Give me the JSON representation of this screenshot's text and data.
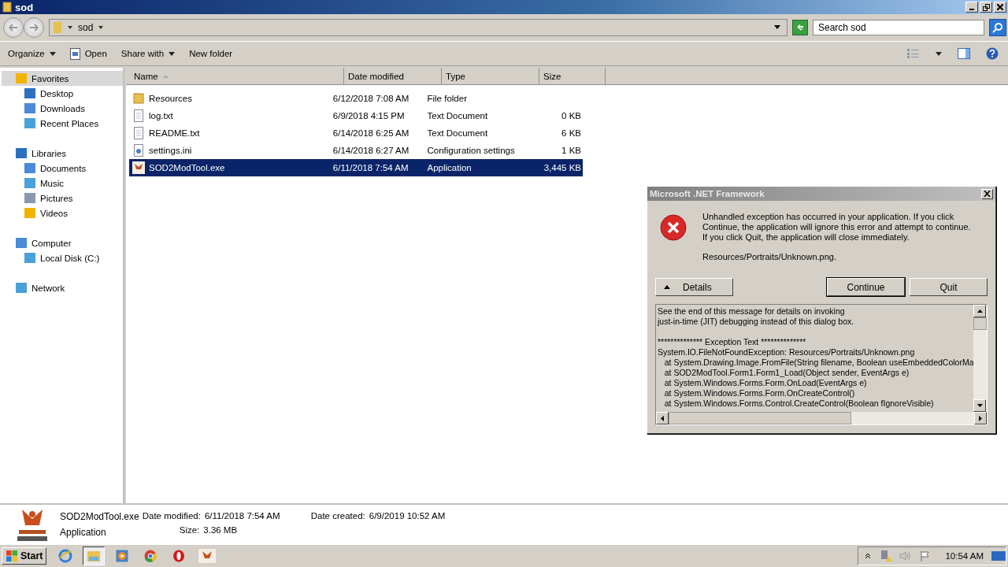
{
  "window": {
    "title": "sod"
  },
  "address": {
    "crumbs": [
      "sod"
    ]
  },
  "search": {
    "placeholder": "Search sod"
  },
  "toolbar": {
    "items": [
      {
        "label": "Organize",
        "kind": "menu"
      },
      {
        "label": "Open",
        "kind": "open"
      },
      {
        "label": "Share with",
        "kind": "menu"
      },
      {
        "label": "New folder",
        "kind": "plain"
      }
    ]
  },
  "sidebar": {
    "items": [
      {
        "label": "Favorites",
        "selected": true,
        "children": [
          {
            "label": "Desktop",
            "selected": false
          },
          {
            "label": "Downloads",
            "selected": false
          },
          {
            "label": "Recent Places",
            "selected": false
          }
        ]
      },
      {
        "label": "Libraries",
        "selected": false,
        "children": [
          {
            "label": "Documents",
            "selected": false
          },
          {
            "label": "Music",
            "selected": false
          },
          {
            "label": "Pictures",
            "selected": false
          },
          {
            "label": "Videos",
            "selected": false
          }
        ]
      },
      {
        "label": "Computer",
        "selected": false,
        "children": [
          {
            "label": "Local Disk (C:)",
            "selected": false
          }
        ]
      },
      {
        "label": "Network",
        "selected": false
      }
    ]
  },
  "table": {
    "columns": [
      {
        "label": "Name",
        "sorted": true
      },
      {
        "label": "Date modified",
        "sorted": false
      },
      {
        "label": "Type",
        "sorted": false
      },
      {
        "label": "Size",
        "sorted": false
      }
    ],
    "rows": [
      {
        "kind": "folder",
        "name": "Resources",
        "date": "6/12/2018 7:08 AM",
        "type": "File folder",
        "selected": false
      },
      {
        "kind": "text",
        "name": "log.txt",
        "date": "6/9/2018 4:15 PM",
        "type": "Text Document",
        "size": "0 KB",
        "selected": false
      },
      {
        "kind": "text",
        "name": "README.txt",
        "date": "6/14/2018 6:25 AM",
        "type": "Text Document",
        "size": "6 KB",
        "selected": false
      },
      {
        "kind": "settings",
        "name": "settings.ini",
        "date": "6/14/2018 6:27 AM",
        "type": "Configuration settings",
        "size": "1 KB",
        "selected": false
      },
      {
        "kind": "app",
        "name": "SOD2ModTool.exe",
        "date": "6/11/2018 7:54 AM",
        "type": "Application",
        "size": "3,445 KB",
        "selected": true
      }
    ]
  },
  "details_pane": {
    "name": "SOD2ModTool.exe",
    "type": "Application",
    "fields": [
      {
        "label": "Date modified:",
        "value": "6/11/2018 7:54 AM"
      },
      {
        "label": "Size:",
        "value": "3.36 MB"
      },
      {
        "label": "Date created:",
        "value": "6/9/2019 10:52 AM"
      }
    ]
  },
  "dialog": {
    "title": "Microsoft .NET Framework",
    "message": "Unhandled exception has occurred in your application. If you click Continue, the application will ignore this error and attempt to continue. If you click Quit, the application will close immediately.",
    "detail": "Resources/Portraits/Unknown.png.",
    "details_button": "Details",
    "buttons": [
      {
        "label": "Continue",
        "selected": true
      },
      {
        "label": "Quit",
        "selected": false
      }
    ],
    "log": [
      [
        "See the end of this message for details on invoking",
        "just-in-time (JIT) debugging instead of this dialog box."
      ],
      [
        "************** Exception Text **************",
        "System.IO.FileNotFoundException: Resources/Portraits/Unknown.png",
        "   at System.Drawing.Image.FromFile(String filename, Boolean useEmbeddedColorMa",
        "   at SOD2ModTool.Form1.Form1_Load(Object sender, EventArgs e)",
        "   at System.Windows.Forms.Form.OnLoad(EventArgs e)",
        "   at System.Windows.Forms.Form.OnCreateControl()",
        "   at System.Windows.Forms.Control.CreateControl(Boolean fIgnoreVisible)"
      ]
    ]
  },
  "taskbar": {
    "start": "Start",
    "apps": [
      {
        "kind": "browser",
        "selected": false
      },
      {
        "kind": "explorer",
        "selected": true
      },
      {
        "kind": "media",
        "selected": false
      },
      {
        "kind": "chrome",
        "selected": false
      },
      {
        "kind": "opera",
        "selected": false
      },
      {
        "kind": "game",
        "selected": false
      }
    ],
    "clock": "10:54 AM"
  }
}
